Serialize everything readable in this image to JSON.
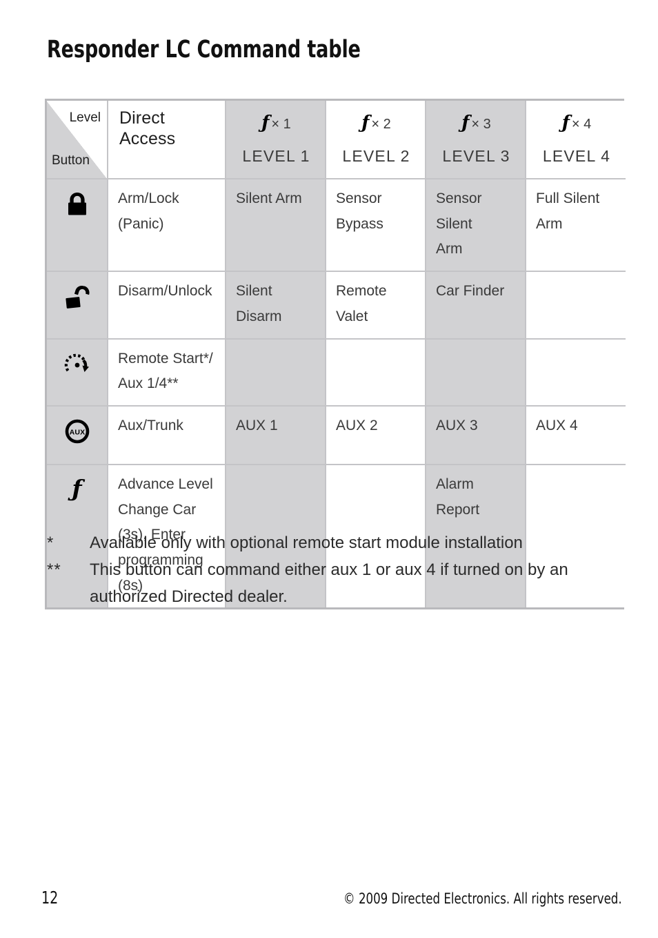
{
  "document": {
    "title": "Responder LC Command table"
  },
  "table": {
    "corner": {
      "level_label": "Level",
      "button_label": "Button"
    },
    "columns": [
      {
        "id": "direct",
        "label": "Direct Access",
        "shaded": false
      },
      {
        "id": "level1",
        "fx": "ƒ",
        "multiplier": "× 1",
        "label": "LEVEL 1",
        "shaded": true
      },
      {
        "id": "level2",
        "fx": "ƒ",
        "multiplier": "× 2",
        "label": "LEVEL 2",
        "shaded": false
      },
      {
        "id": "level3",
        "fx": "ƒ",
        "multiplier": "× 3",
        "label": "LEVEL 3",
        "shaded": true
      },
      {
        "id": "level4",
        "fx": "ƒ",
        "multiplier": "× 4",
        "label": "LEVEL 4",
        "shaded": false
      }
    ],
    "rows": [
      {
        "icon": "closed-padlock-icon",
        "direct": "Arm/Lock\n(Panic)",
        "level1": "Silent Arm",
        "level2": "Sensor\nBypass",
        "level3": "Sensor Silent\nArm",
        "level4": "Full Silent\nArm"
      },
      {
        "icon": "open-padlock-icon",
        "direct": "Disarm/Unlock",
        "level1": "Silent Disarm",
        "level2": "Remote Valet",
        "level3": "Car Finder",
        "level4": ""
      },
      {
        "icon": "remote-start-icon",
        "direct": "Remote Start*/\nAux 1/4**",
        "level1": "",
        "level2": "",
        "level3": "",
        "level4": ""
      },
      {
        "icon": "aux-circle-icon",
        "direct": "Aux/Trunk",
        "level1": "AUX 1",
        "level2": "AUX 2",
        "level3": "AUX 3",
        "level4": "AUX 4"
      },
      {
        "icon": "script-f-icon",
        "direct": "Advance Level\nChange Car\n(3s), Enter\nprogramming\n(8s)",
        "level1": "",
        "level2": "",
        "level3": "Alarm\nReport",
        "level4": ""
      }
    ]
  },
  "footnotes": [
    {
      "mark": "*",
      "text": "Available only with optional remote start module installation"
    },
    {
      "mark": "**",
      "text": "This button can command either aux 1 or aux 4 if turned on by an authorized Directed dealer."
    }
  ],
  "footer": {
    "page_number": "12",
    "copyright": "© 2009 Directed Electronics. All rights reserved."
  },
  "colors": {
    "shade": "#d2d2d4",
    "border_outer": "#b9b9bc",
    "border_inner": "#c4c4c7",
    "text": "#3a3a3a"
  }
}
